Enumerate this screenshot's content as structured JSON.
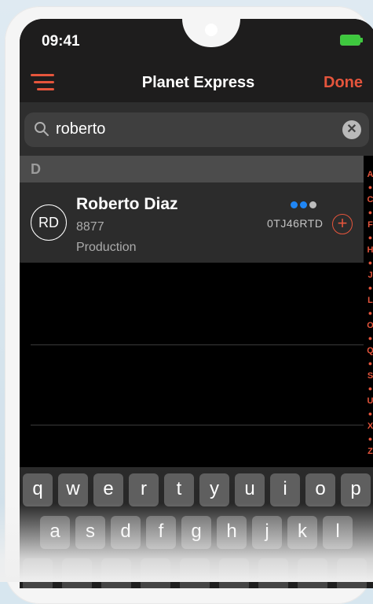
{
  "status": {
    "time": "09:41"
  },
  "nav": {
    "title": "Planet Express",
    "done_label": "Done"
  },
  "search": {
    "value": "roberto"
  },
  "section": {
    "header": "D"
  },
  "contact": {
    "initials": "RD",
    "name": "Roberto Diaz",
    "extension": "8877",
    "department": "Production",
    "code": "0TJ46RTD",
    "status_dots": [
      "#1f86f5",
      "#1f86f5",
      "#bdbdbd"
    ]
  },
  "index_letters": [
    "A",
    "C",
    "F",
    "H",
    "J",
    "L",
    "O",
    "Q",
    "S",
    "U",
    "X",
    "Z"
  ],
  "keyboard": {
    "row1": [
      "q",
      "w",
      "e",
      "r",
      "t",
      "y",
      "u",
      "i",
      "o",
      "p"
    ],
    "row2": [
      "a",
      "s",
      "d",
      "f",
      "g",
      "h",
      "j",
      "k",
      "l"
    ]
  },
  "colors": {
    "accent": "#e5553c",
    "battery": "#3ec93e"
  }
}
